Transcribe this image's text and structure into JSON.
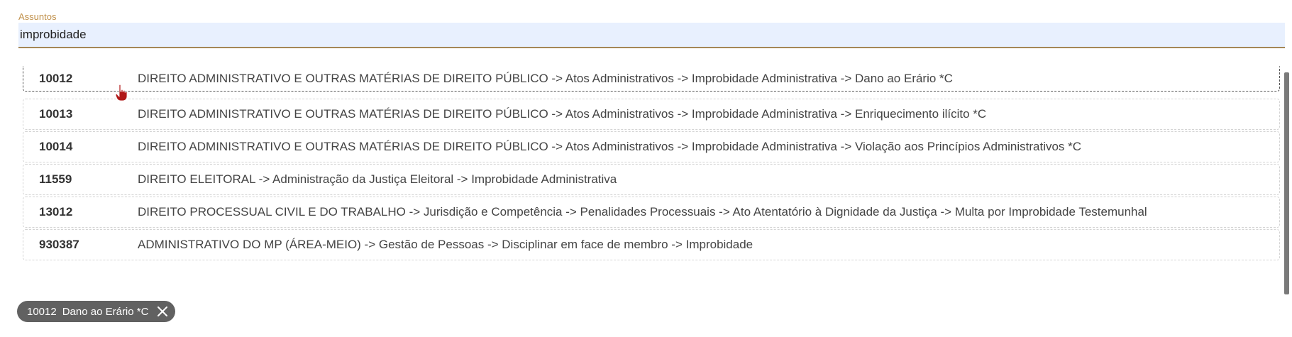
{
  "field": {
    "label": "Assuntos",
    "value": "improbidade"
  },
  "results": [
    {
      "code": "10012",
      "text": "DIREITO ADMINISTRATIVO E OUTRAS MATÉRIAS DE DIREITO PÚBLICO -> Atos Administrativos -> Improbidade Administrativa -> Dano ao Erário *C"
    },
    {
      "code": "10013",
      "text": "DIREITO ADMINISTRATIVO E OUTRAS MATÉRIAS DE DIREITO PÚBLICO -> Atos Administrativos -> Improbidade Administrativa -> Enriquecimento ilícito *C"
    },
    {
      "code": "10014",
      "text": "DIREITO ADMINISTRATIVO E OUTRAS MATÉRIAS DE DIREITO PÚBLICO -> Atos Administrativos -> Improbidade Administrativa -> Violação aos Princípios Administrativos *C"
    },
    {
      "code": "11559",
      "text": "DIREITO ELEITORAL -> Administração da Justiça Eleitoral -> Improbidade Administrativa"
    },
    {
      "code": "13012",
      "text": "DIREITO PROCESSUAL CIVIL E DO TRABALHO -> Jurisdição e Competência -> Penalidades Processuais -> Ato Atentatório à Dignidade da Justiça -> Multa por Improbidade Testemunhal"
    },
    {
      "code": "930387",
      "text": "ADMINISTRATIVO DO MP (ÁREA-MEIO) -> Gestão de Pessoas -> Disciplinar em face de membro -> Improbidade"
    }
  ],
  "selected_chip": {
    "code": "10012",
    "text": "Dano ao Erário *C",
    "close_icon": "close-icon"
  },
  "colors": {
    "label": "#c0904a",
    "input_bg": "#e8f0fe",
    "underline": "#a58756",
    "chip_bg": "#616161"
  }
}
